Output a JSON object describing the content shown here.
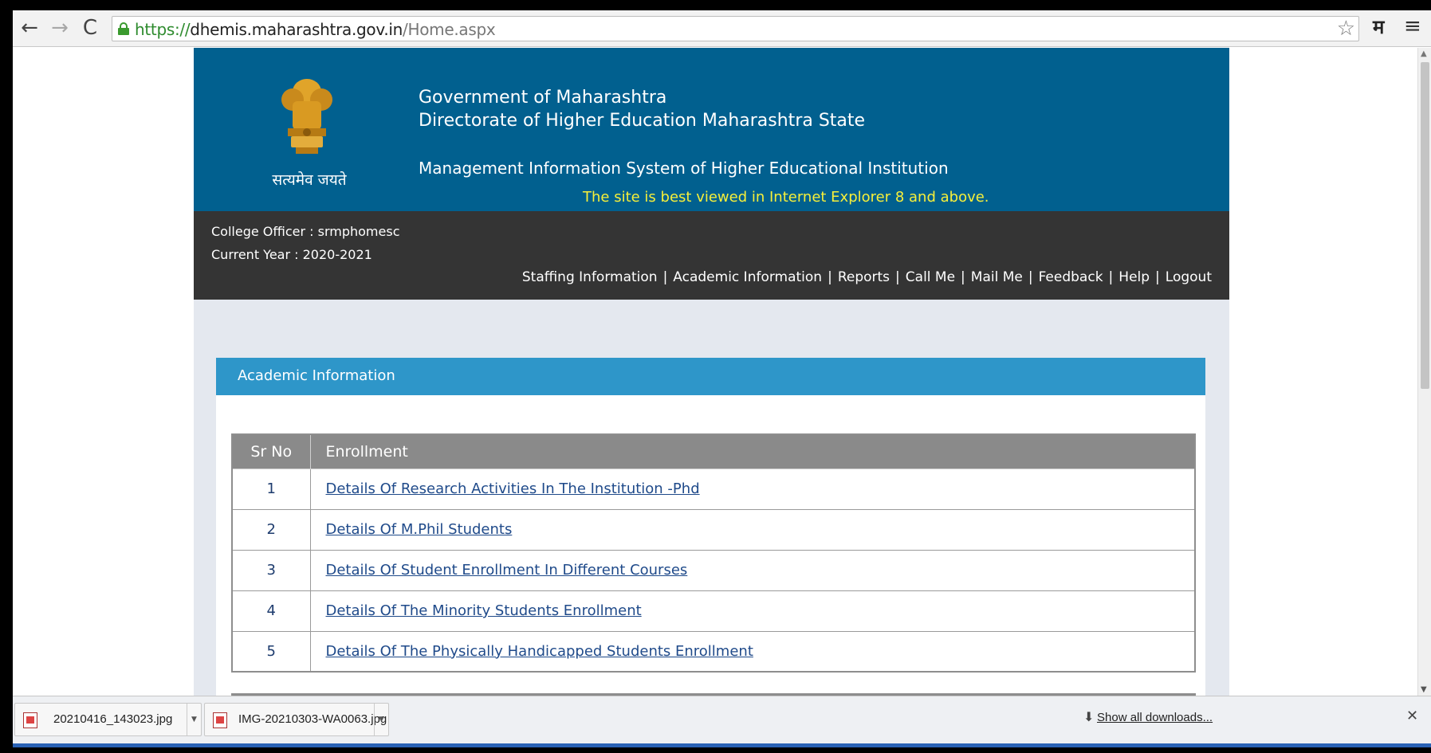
{
  "browser": {
    "url_scheme": "https://",
    "url_host": "dhemis.maharashtra.gov.in",
    "url_path": "/Home.aspx",
    "back_glyph": "←",
    "forward_glyph": "→",
    "reload_glyph": "C",
    "star_glyph": "☆",
    "lang_glyph": "म",
    "menu_glyph": "≡"
  },
  "header": {
    "motto": "सत्यमेव जयते",
    "gov_title": "Government of Maharashtra",
    "dir_title": "Directorate of Higher Education Maharashtra State",
    "mis_title": "Management Information System of Higher Educational Institution",
    "best_viewed": "The site is best viewed in Internet Explorer 8 and above."
  },
  "userbar": {
    "officer": "College Officer : srmphomesc",
    "year": "Current Year : 2020-2021",
    "nav": [
      "Staffing Information",
      "Academic Information",
      "Reports",
      "Call Me",
      "Mail Me",
      "Feedback",
      "Help",
      "Logout"
    ],
    "separator": "|"
  },
  "panel": {
    "title": "Academic Information",
    "table": {
      "headers": {
        "srno": "Sr No",
        "enrollment": "Enrollment"
      },
      "rows": [
        {
          "srno": "1",
          "label": "Details Of Research Activities In The Institution -Phd"
        },
        {
          "srno": "2",
          "label": "Details Of M.Phil Students"
        },
        {
          "srno": "3",
          "label": "Details Of Student Enrollment In Different Courses"
        },
        {
          "srno": "4",
          "label": "Details Of The Minority Students Enrollment"
        },
        {
          "srno": "5",
          "label": "Details Of The Physically Handicapped Students Enrollment"
        }
      ]
    }
  },
  "downloads": {
    "items": [
      {
        "name": "20210416_143023.jpg"
      },
      {
        "name": "IMG-20210303-WA0063.jpg"
      }
    ],
    "show_all": "Show all downloads...",
    "close_glyph": "✕"
  },
  "colors": {
    "header_bg": "#01608f",
    "userbar_bg": "#343434",
    "panel_head_bg": "#2e96c9",
    "best_viewed_text": "#f7ef3a",
    "table_head_bg": "#8a8a8a"
  }
}
